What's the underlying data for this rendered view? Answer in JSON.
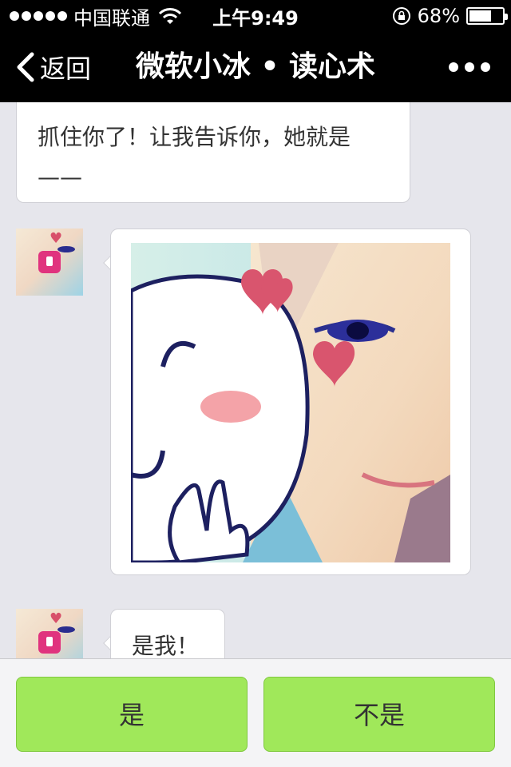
{
  "status_bar": {
    "carrier": "中国联通",
    "time": "上午9:49",
    "battery": "68%",
    "battery_level": 0.68,
    "icons": [
      "signal-dots-icon",
      "wifi-icon",
      "rotation-lock-icon",
      "battery-icon"
    ]
  },
  "nav": {
    "back_label": "返回",
    "title": "微软小冰 • 读心术",
    "icons": [
      "chevron-left-icon",
      "more-icon"
    ]
  },
  "messages": [
    {
      "type": "text",
      "text": "抓住你了！让我告诉你，她就是——"
    },
    {
      "type": "image"
    },
    {
      "type": "text",
      "text": "是我！"
    }
  ],
  "actions": {
    "yes_label": "是",
    "no_label": "不是"
  },
  "colors": {
    "bar_bg": "#000000",
    "chat_bg": "#e6e6ec",
    "button_green": "#a0e85a",
    "badge_pink": "#e0337e"
  }
}
